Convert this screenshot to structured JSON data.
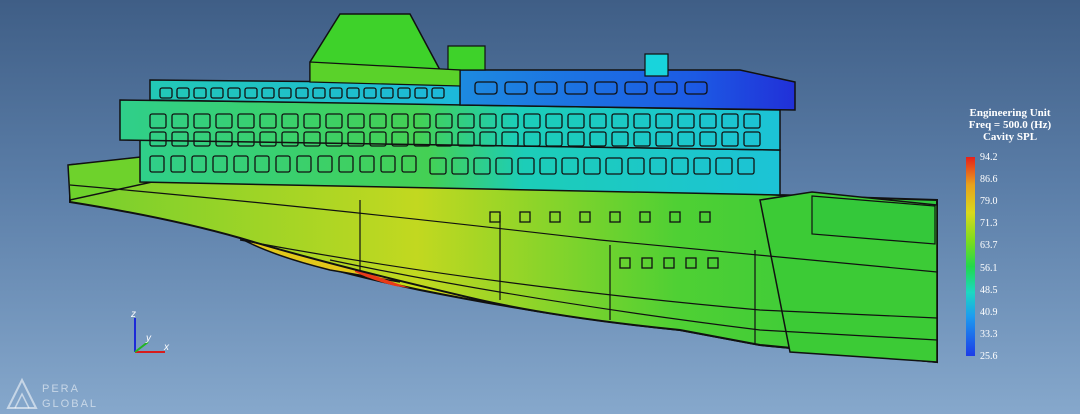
{
  "legend": {
    "title_line1": "Engineering Unit",
    "title_line2": "Freq = 500.0 (Hz)",
    "title_line3": "Cavity SPL",
    "ticks": [
      "94.2",
      "86.6",
      "79.0",
      "71.3",
      "63.7",
      "56.1",
      "48.5",
      "40.9",
      "33.3",
      "25.6"
    ]
  },
  "axes": {
    "x": "x",
    "y": "y",
    "z": "z"
  },
  "logo": {
    "line1": "PERA",
    "line2": "GLOBAL"
  },
  "colors": {
    "hull_green": "#3ecf32",
    "hull_yellow": "#d8dc18",
    "deck_cyan": "#1cc8c8",
    "deck_blue": "#1c6ee8",
    "outline": "#111111"
  }
}
